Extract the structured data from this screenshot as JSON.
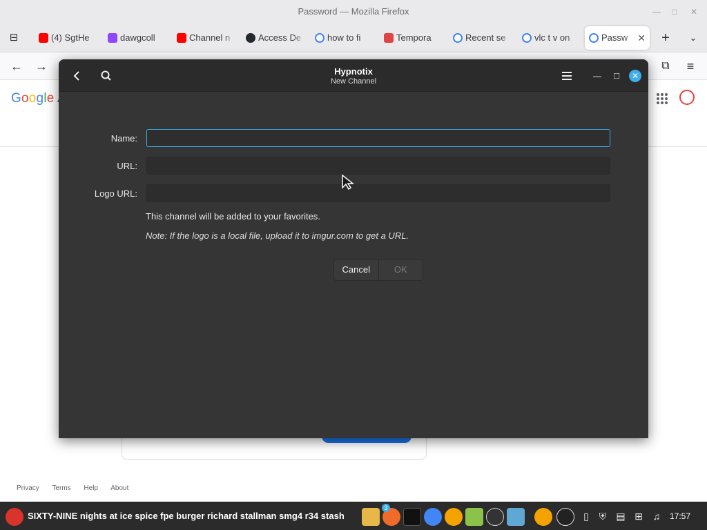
{
  "firefox": {
    "window_title": "Password — Mozilla Firefox",
    "tabs": [
      {
        "label": "(4) SgtHe",
        "favicon": "youtube-icon",
        "color": "#ff0000"
      },
      {
        "label": "dawgcoll",
        "favicon": "twitch-icon",
        "color": "#9146ff"
      },
      {
        "label": "Channel n",
        "favicon": "youtube-icon",
        "color": "#ff0000"
      },
      {
        "label": "Access De",
        "favicon": "github-icon",
        "color": "#24292e"
      },
      {
        "label": "how to fi",
        "favicon": "google-icon",
        "color": "#4285f4"
      },
      {
        "label": "Tempora",
        "favicon": "mail-icon",
        "color": "#e04545"
      },
      {
        "label": "Recent se",
        "favicon": "google-icon",
        "color": "#4285f4"
      },
      {
        "label": "vlc t v on",
        "favicon": "google-icon",
        "color": "#4285f4"
      },
      {
        "label": "Passw",
        "favicon": "google-icon",
        "color": "#4285f4",
        "active": true
      }
    ]
  },
  "page": {
    "logo_text": "Google A",
    "footer": [
      "Privacy",
      "Terms",
      "Help",
      "About"
    ]
  },
  "dialog": {
    "title": "Hypnotix",
    "subtitle": "New Channel",
    "fields": [
      {
        "label": "Name:",
        "value": "",
        "focused": true
      },
      {
        "label": "URL:",
        "value": ""
      },
      {
        "label": "Logo URL:",
        "value": ""
      }
    ],
    "favorites_note": "This channel will be added to your favorites.",
    "logo_note": "Note: If the logo is a local file, upload it to imgur.com to get a URL.",
    "cancel_label": "Cancel",
    "ok_label": "OK"
  },
  "taskbar": {
    "window_title": "SIXTY-NINE nights at ice spice fpe burger richard stallman smg4 r34 stash",
    "badge_count": "3",
    "clock": "17:57"
  },
  "colors": {
    "accent": "#3daee9",
    "dialog_bg": "#353535",
    "header_bg": "#2b2b2b"
  }
}
